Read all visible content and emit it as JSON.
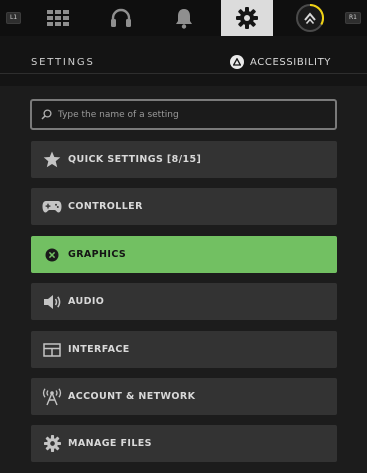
{
  "bumpers": {
    "left": "L1",
    "right": "R1"
  },
  "tabs": [
    {
      "icon": "grid-icon",
      "active": false
    },
    {
      "icon": "headset-icon",
      "active": false
    },
    {
      "icon": "bell-icon",
      "active": false
    },
    {
      "icon": "gear-icon",
      "active": true
    },
    {
      "icon": "rank-badge-icon",
      "active": false
    }
  ],
  "header": {
    "title": "SETTINGS",
    "accessibility_label": "ACCESSIBILITY",
    "accessibility_icon": "triangle-button-icon"
  },
  "search": {
    "placeholder": "Type the name of a setting",
    "value": ""
  },
  "menu": [
    {
      "label": "QUICK SETTINGS [8/15]",
      "icon": "star-icon",
      "selected": false
    },
    {
      "label": "CONTROLLER",
      "icon": "gamepad-icon",
      "selected": false
    },
    {
      "label": "GRAPHICS",
      "icon": "cross-button-icon",
      "selected": true
    },
    {
      "label": "AUDIO",
      "icon": "speaker-icon",
      "selected": false
    },
    {
      "label": "INTERFACE",
      "icon": "interface-icon",
      "selected": false
    },
    {
      "label": "ACCOUNT & NETWORK",
      "icon": "network-icon",
      "selected": false
    },
    {
      "label": "MANAGE FILES",
      "icon": "gear-icon",
      "selected": false
    }
  ],
  "colors": {
    "selected_item": "#72c062",
    "item_bg": "#333333",
    "rank_ring": "#f0d214"
  }
}
